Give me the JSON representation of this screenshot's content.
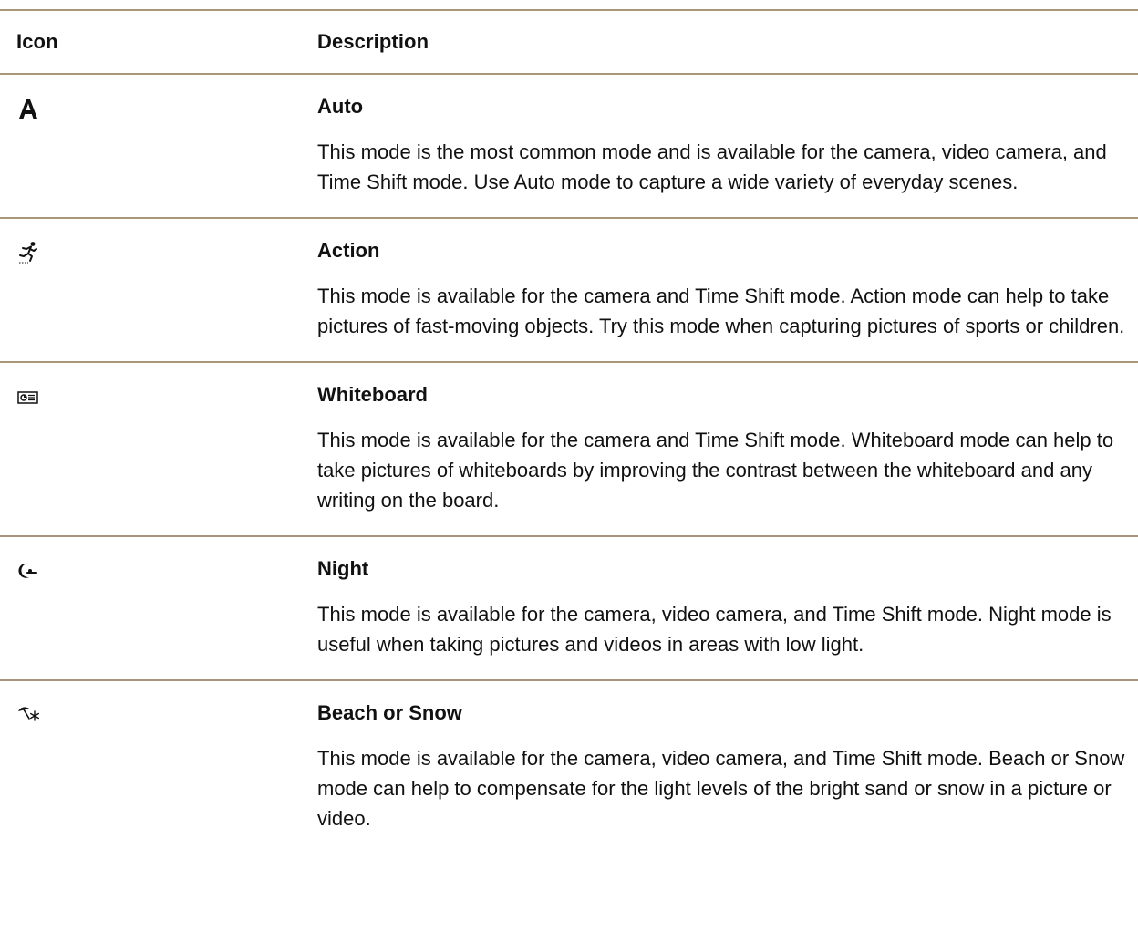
{
  "table": {
    "header": {
      "icon_col": "Icon",
      "desc_col": "Description"
    },
    "rows": [
      {
        "icon": "auto-icon",
        "name": "Auto",
        "description": "This mode is the most common mode and is available for the camera, video camera, and Time Shift mode. Use Auto mode to capture a wide variety of everyday scenes."
      },
      {
        "icon": "action-icon",
        "name": "Action",
        "description": "This mode is available for the camera and Time Shift mode. Action mode can help to take pictures of fast-moving objects. Try this mode when capturing pictures of sports or children."
      },
      {
        "icon": "whiteboard-icon",
        "name": "Whiteboard",
        "description": "This mode is available for the camera and Time Shift mode. Whiteboard mode can help to take pictures of whiteboards by improving the contrast between the whiteboard and any writing on the board."
      },
      {
        "icon": "night-icon",
        "name": "Night",
        "description": "This mode is available for the camera, video camera, and Time Shift mode. Night mode is useful when taking pictures and videos in areas with low light."
      },
      {
        "icon": "beach-snow-icon",
        "name": "Beach or Snow",
        "description": "This mode is available for the camera, video camera, and Time Shift mode. Beach or Snow mode can help to compensate for the light levels of the bright sand or snow in a picture or video."
      }
    ]
  },
  "colors": {
    "rule": "#a8967a",
    "text": "#111111"
  }
}
